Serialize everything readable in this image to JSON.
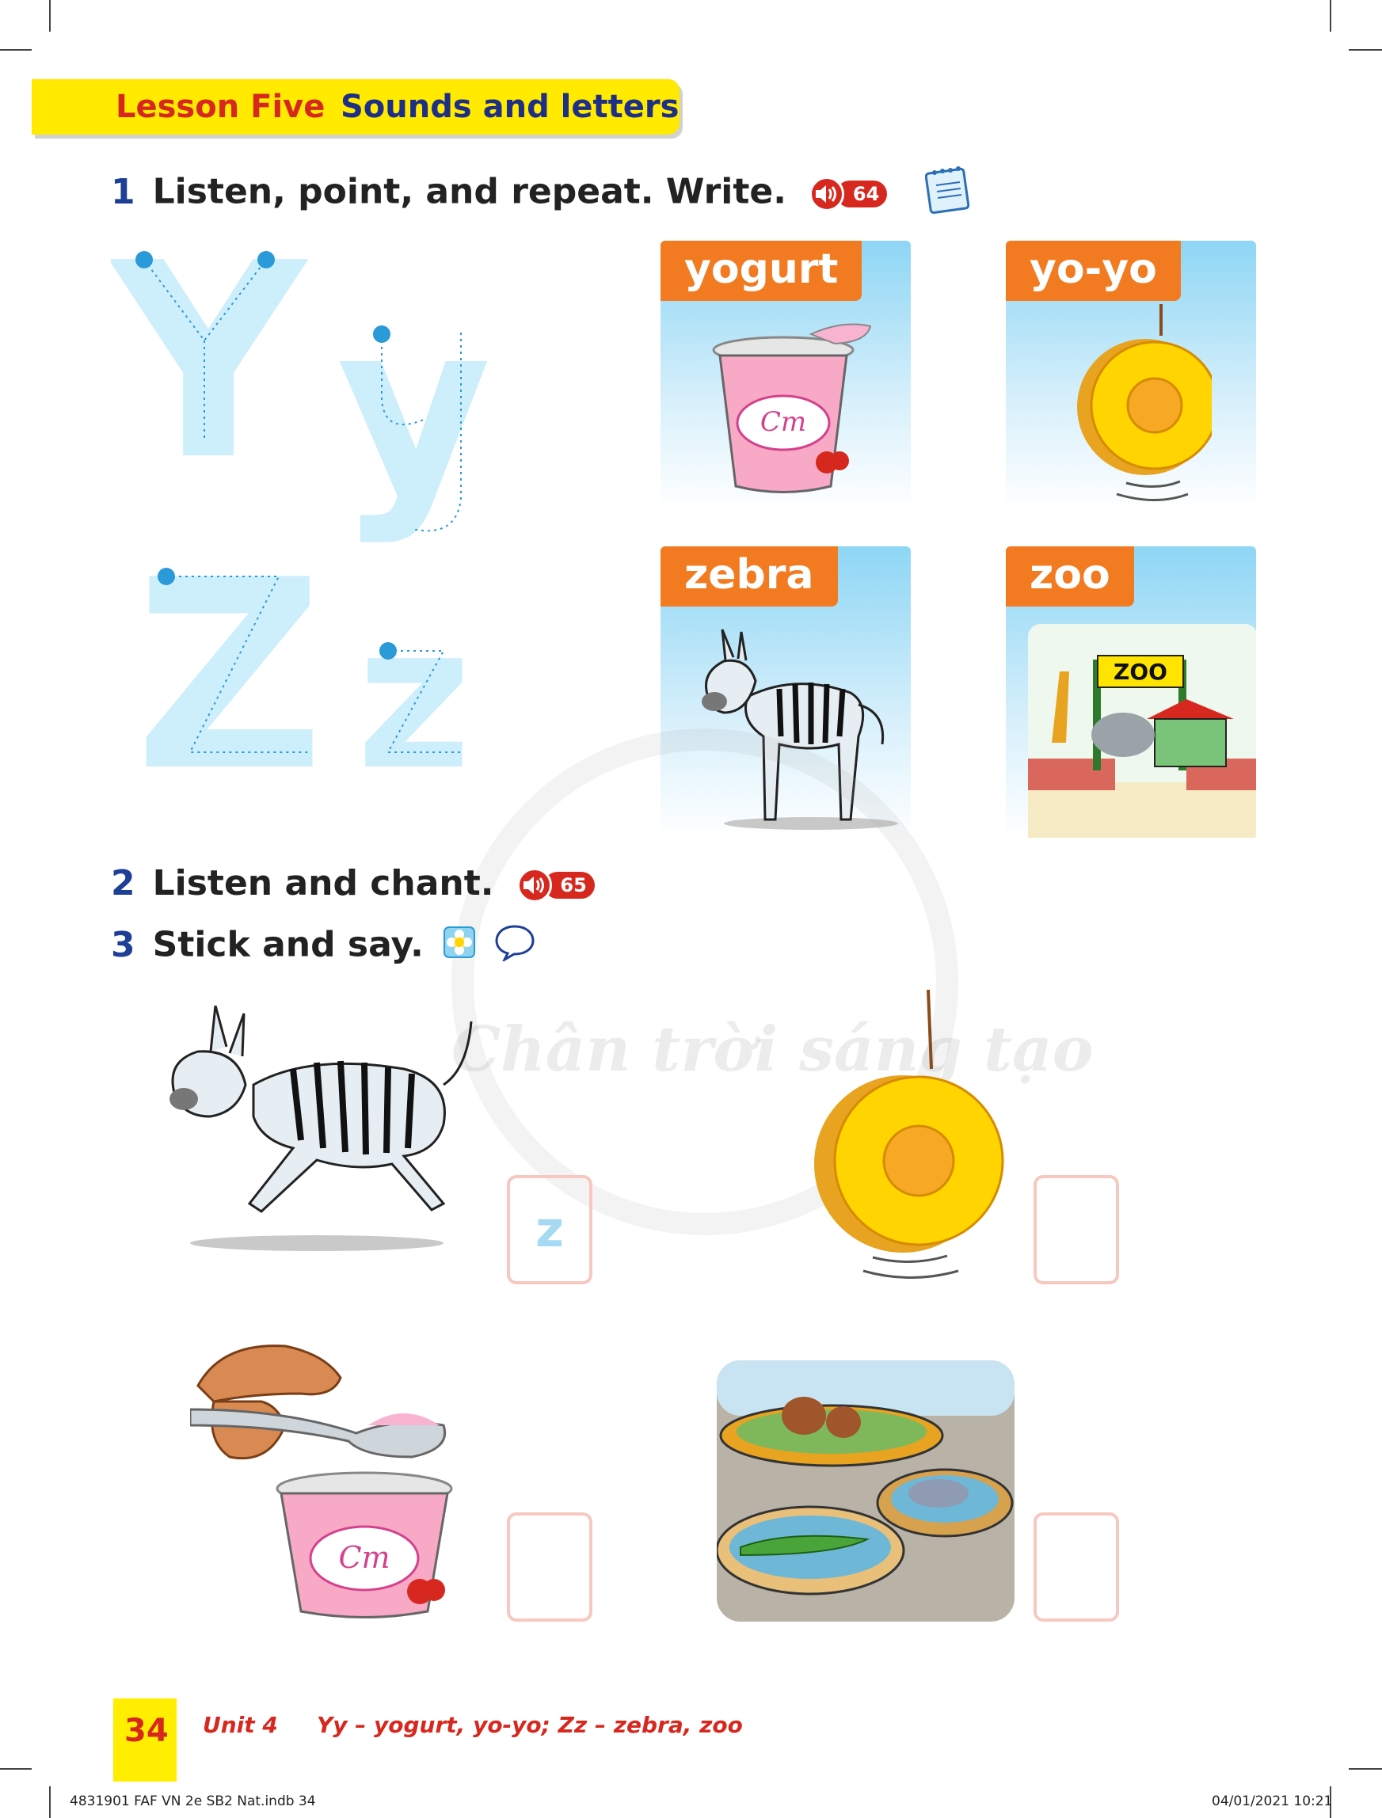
{
  "header": {
    "lesson": "Lesson Five",
    "title": "Sounds and letters"
  },
  "activity1": {
    "number": "1",
    "instruction": "Listen, point, and repeat. Write.",
    "track": "64"
  },
  "tracing": {
    "upper_y": "Y",
    "lower_y": "y",
    "upper_z": "Z",
    "lower_z": "z"
  },
  "cards": [
    {
      "label": "yogurt",
      "icon": "yogurt-icon"
    },
    {
      "label": "yo-yo",
      "icon": "yoyo-icon"
    },
    {
      "label": "zebra",
      "icon": "zebra-icon"
    },
    {
      "label": "zoo",
      "icon": "zoo-icon"
    }
  ],
  "zoo_sign": "ZOO",
  "activity2": {
    "number": "2",
    "instruction": "Listen and chant.",
    "track": "65"
  },
  "activity3": {
    "number": "3",
    "instruction": "Stick and say."
  },
  "answer_boxes": {
    "zebra": "z",
    "yoyo": "",
    "yogurt": "",
    "zoo": ""
  },
  "watermark": "Chân trời sáng tạo",
  "footer": {
    "page_number": "34",
    "unit": "Unit 4",
    "topic": "Yy – yogurt, yo-yo; Zz – zebra, zoo",
    "file": "4831901 FAF VN 2e SB2 Nat.indb   34",
    "timestamp": "04/01/2021   10:21"
  },
  "colors": {
    "banner": "#ffea00",
    "lesson": "#d7281f",
    "title": "#1d2f86",
    "tag": "#f27b21",
    "trace": "#bfe6f8"
  }
}
